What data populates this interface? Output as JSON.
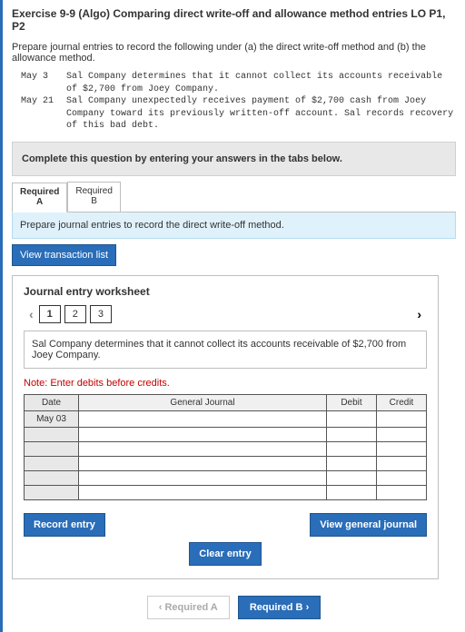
{
  "header": {
    "title": "Exercise 9-9 (Algo) Comparing direct write-off and allowance method entries LO P1, P2",
    "intro": "Prepare journal entries to record the following under (a) the direct write-off method and (b) the allowance method."
  },
  "transactions": [
    {
      "date": "May 3",
      "text": "Sal Company determines that it cannot collect its accounts receivable of $2,700 from Joey Company."
    },
    {
      "date": "May 21",
      "text": "Sal Company unexpectedly receives payment of $2,700 cash from Joey Company toward its previously written-off account. Sal records recovery of this bad debt."
    }
  ],
  "complete_bar": "Complete this question by entering your answers in the tabs below.",
  "tabs": {
    "a": "Required A",
    "b": "Required B"
  },
  "sub_instr": "Prepare journal entries to record the direct write-off method.",
  "view_list": "View transaction list",
  "worksheet": {
    "title": "Journal entry worksheet",
    "entries": [
      "1",
      "2",
      "3"
    ],
    "desc": "Sal Company determines that it cannot collect its accounts receivable of $2,700 from Joey Company.",
    "note": "Note: Enter debits before credits.",
    "cols": {
      "date": "Date",
      "gj": "General Journal",
      "debit": "Debit",
      "credit": "Credit"
    },
    "first_date": "May 03",
    "buttons": {
      "record": "Record entry",
      "clear": "Clear entry",
      "view": "View general journal"
    }
  },
  "nav": {
    "prev": "Required A",
    "next": "Required B"
  }
}
